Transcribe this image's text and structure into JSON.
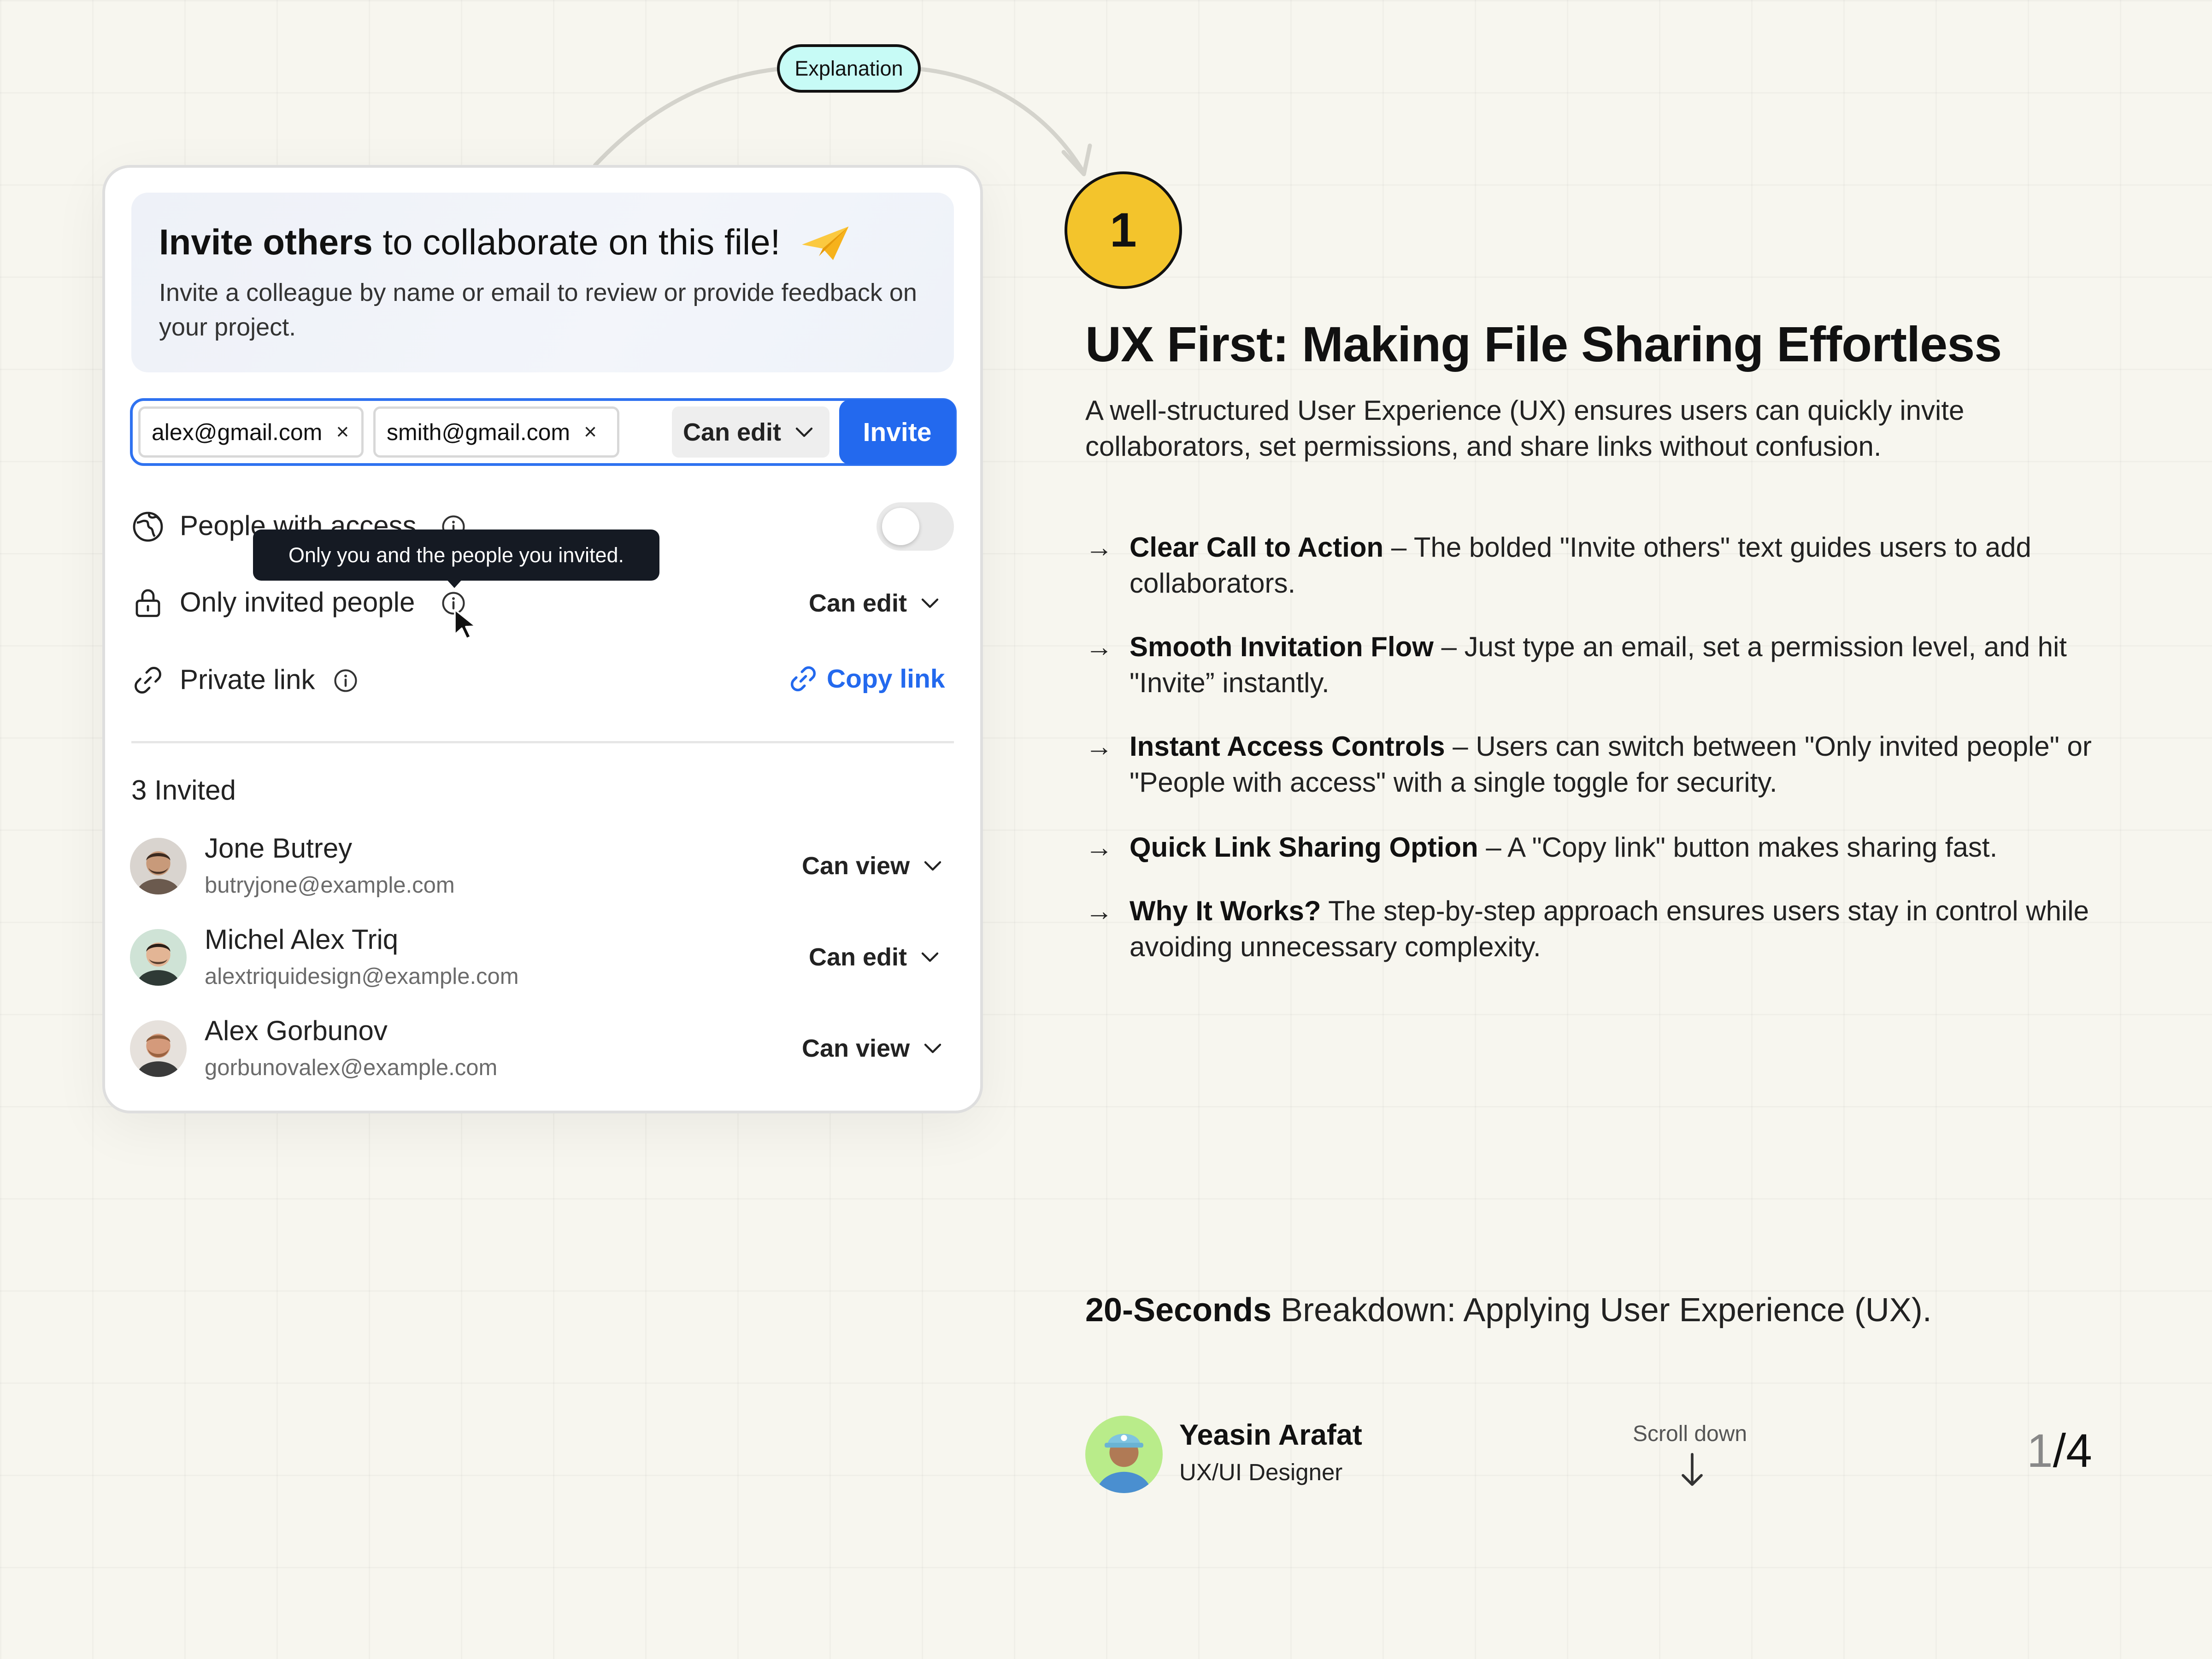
{
  "explanation": {
    "label": "Explanation"
  },
  "card": {
    "banner": {
      "title_bold": "Invite others",
      "title_rest": " to collaborate on this file!",
      "description": "Invite a colleague by name or email to review or provide feedback on your project."
    },
    "invite_field": {
      "chips": [
        {
          "email": "alex@gmail.com",
          "remove": "×"
        },
        {
          "email": "smith@gmail.com",
          "remove": "×"
        }
      ],
      "permission": "Can edit",
      "invite_label": "Invite"
    },
    "access": {
      "people_with_access": {
        "label": "People with access",
        "toggle_on": false
      },
      "tooltip": "Only you and the people you invited.",
      "only_invited": {
        "label": "Only invited people",
        "permission": "Can edit"
      },
      "private_link": {
        "label": "Private link",
        "action": "Copy link"
      }
    },
    "invited": {
      "count_label": "3 Invited",
      "people": [
        {
          "name": "Jone Butrey",
          "email": "butryjone@example.com",
          "permission": "Can view"
        },
        {
          "name": "Michel Alex Triq",
          "email": "alextriquidesign@example.com",
          "permission": "Can edit"
        },
        {
          "name": "Alex Gorbunov",
          "email": "gorbunovalex@example.com",
          "permission": "Can view"
        }
      ]
    }
  },
  "right": {
    "step_number": "1",
    "headline": "UX First: Making File Sharing Effortless",
    "intro": "A well-structured User Experience (UX) ensures users can quickly invite collaborators, set permissions, and share links without confusion.",
    "bullets": [
      {
        "bold": "Clear Call to Action",
        "text": " – The bolded \"Invite others\" text guides users to add collaborators."
      },
      {
        "bold": "Smooth Invitation Flow",
        "text": " – Just type an email, set a permission level, and hit \"Invite” instantly."
      },
      {
        "bold": "Instant Access Controls",
        "text": " – Users can switch between \"Only invited people\" or \"People with access\" with a single toggle for security."
      },
      {
        "bold": "Quick Link Sharing Option",
        "text": " – A \"Copy link\" button makes sharing fast."
      },
      {
        "bold": "Why It Works?",
        "text": " The step-by-step approach ensures users stay in control while avoiding unnecessary complexity."
      }
    ],
    "breakdown_bold": "20-Seconds",
    "breakdown_rest": " Breakdown: Applying User Experience (UX).",
    "author": {
      "name": "Yeasin Arafat",
      "role": "UX/UI Designer"
    },
    "scroll_label": "Scroll down",
    "pager": {
      "current": "1",
      "total": "/4"
    }
  },
  "colors": {
    "accent": "#2369ee",
    "badge": "#f3c42c",
    "pill": "#c7fbf6",
    "background": "#f7f6ef"
  },
  "icons": [
    "globe-icon",
    "lock-icon",
    "link-icon",
    "info-icon",
    "chevron-down-icon",
    "close-icon",
    "paper-plane-icon",
    "cursor-icon",
    "arrow-right-icon",
    "arrow-down-icon"
  ]
}
